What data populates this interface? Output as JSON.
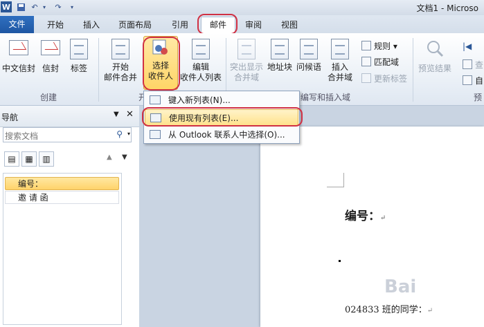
{
  "titlebar": {
    "app_icon": "W",
    "doc_title": "文档1 - Microso",
    "icons": [
      "save-icon",
      "undo-icon",
      "redo-icon",
      "customize-qat-icon"
    ]
  },
  "tabs": {
    "file": "文件",
    "home": "开始",
    "insert": "插入",
    "layout": "页面布局",
    "references": "引用",
    "mailings": "邮件",
    "review": "审阅",
    "view": "视图"
  },
  "ribbon": {
    "create": {
      "label": "创建",
      "chinese_envelope": "中文信封",
      "envelope": "信封",
      "labels": "标签"
    },
    "start": {
      "label": "开",
      "start_merge_l1": "开始",
      "start_merge_l2": "邮件合并",
      "select_l1": "选择",
      "select_l2": "收件人",
      "edit_l1": "编辑",
      "edit_l2": "收件人列表"
    },
    "write": {
      "label": "编写和插入域",
      "highlight_l1": "突出显示",
      "highlight_l2": "合并域",
      "address": "地址块",
      "greeting": "问候语",
      "insert_l1": "插入",
      "insert_l2": "合并域",
      "rules": "规则",
      "match": "匹配域",
      "update": "更新标签"
    },
    "preview": {
      "label": "预",
      "preview_results": "预览结果",
      "find": "查",
      "auto": "自"
    }
  },
  "dropdown": {
    "item1": "键入新列表(N)...",
    "item2": "使用现有列表(E)...",
    "item3": "从 Outlook 联系人中选择(O)..."
  },
  "nav": {
    "title": "导航",
    "search_placeholder": "搜索文档",
    "items": [
      "编号：",
      "邀 请 函"
    ]
  },
  "document": {
    "heading": "编号：",
    "line": "024833 班的同学：",
    "para_mark": "↵",
    "watermark": "Bai"
  }
}
